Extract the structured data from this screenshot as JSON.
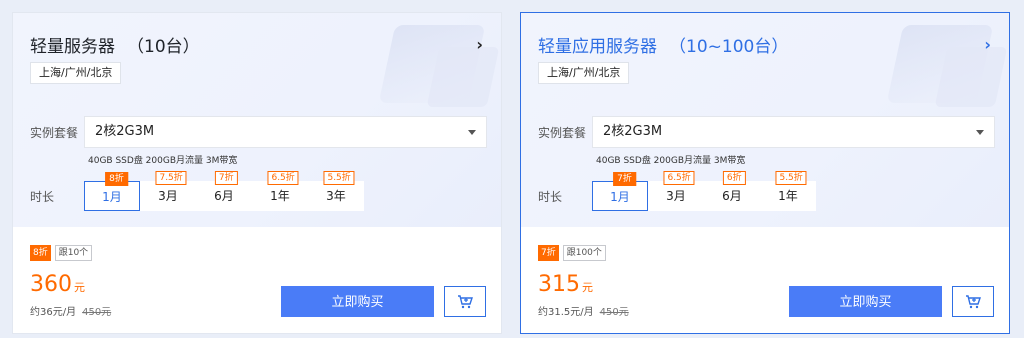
{
  "cards": [
    {
      "title": "轻量服务器",
      "count": "（10台）",
      "region": "上海/广州/北京",
      "package_label": "实例套餐",
      "package_value": "2核2G3M",
      "spec": "40GB SSD盘 200GB月流量 3M带宽",
      "duration_label": "时长",
      "durations": [
        {
          "label": "1月",
          "discount": "8折"
        },
        {
          "label": "3月",
          "discount": "7.5折"
        },
        {
          "label": "6月",
          "discount": "7折"
        },
        {
          "label": "1年",
          "discount": "6.5折"
        },
        {
          "label": "3年",
          "discount": "5.5折"
        }
      ],
      "selected_duration": "1月",
      "discount_badge": "8折",
      "follow_badge": "跟10个",
      "price": "360",
      "price_unit": "元",
      "per_month": "约36元/月",
      "original_price": "450元",
      "buy_label": "立即购买"
    },
    {
      "title": "轻量应用服务器",
      "count": "（10~100台）",
      "region": "上海/广州/北京",
      "package_label": "实例套餐",
      "package_value": "2核2G3M",
      "spec": "40GB SSD盘 200GB月流量 3M带宽",
      "duration_label": "时长",
      "durations": [
        {
          "label": "1月",
          "discount": "7折"
        },
        {
          "label": "3月",
          "discount": "6.5折"
        },
        {
          "label": "6月",
          "discount": "6折"
        },
        {
          "label": "1年",
          "discount": "5.5折"
        }
      ],
      "selected_duration": "1月",
      "discount_badge": "7折",
      "follow_badge": "跟100个",
      "price": "315",
      "price_unit": "元",
      "per_month": "约31.5元/月",
      "original_price": "450元",
      "buy_label": "立即购买"
    }
  ],
  "icons": {
    "chevron": "chevron-right-icon",
    "caret": "caret-down-icon",
    "cart": "cart-plus-icon"
  },
  "colors": {
    "accent": "#2f6fe4",
    "button": "#4a7cf7",
    "discount": "#ff6a00"
  }
}
